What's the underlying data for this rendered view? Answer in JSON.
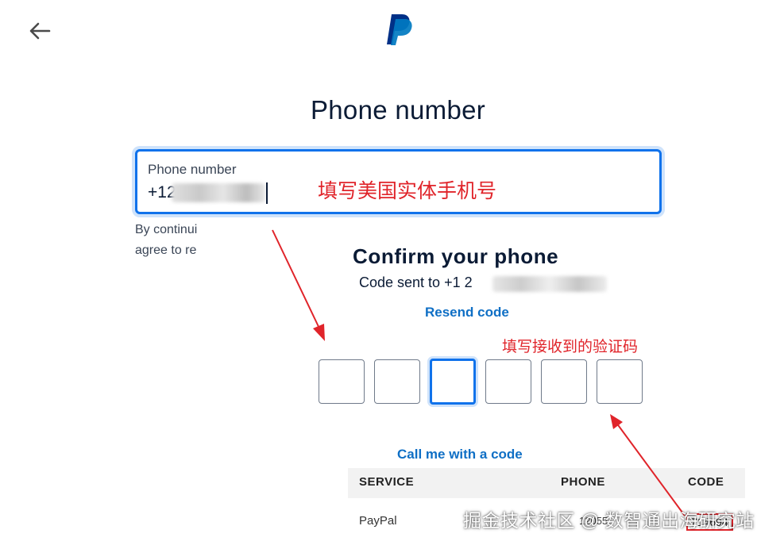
{
  "header": {
    "back_icon": "arrow-left-icon",
    "logo_icon": "paypal-logo-icon"
  },
  "page_title": "Phone number",
  "phone_field": {
    "label": "Phone number",
    "value_prefix": "+12"
  },
  "annotations": {
    "fill_phone": "填写美国实体手机号",
    "fill_code": "填写接收到的验证码",
    "color": "#e0242a"
  },
  "legal_text": {
    "line1": "By continui",
    "line2": "agree to re"
  },
  "confirm": {
    "title": "Confirm your phone",
    "code_sent": "Code sent to +1 2",
    "resend_label": "Resend code",
    "call_me_label": "Call me with a code"
  },
  "otp": {
    "count": 6,
    "active_index": 2
  },
  "sms_table": {
    "headers": {
      "service": "SERVICE",
      "phone": "PHONE",
      "code": "CODE"
    },
    "rows": [
      {
        "service": "PayPal",
        "phone": "12055",
        "code": "714694"
      }
    ]
  },
  "watermark": "掘金技术社区 @ 数智通出海研究站",
  "colors": {
    "accent": "#1072eb",
    "link": "#0f6fc5",
    "annotation": "#e0242a",
    "text": "#0b1b35"
  }
}
